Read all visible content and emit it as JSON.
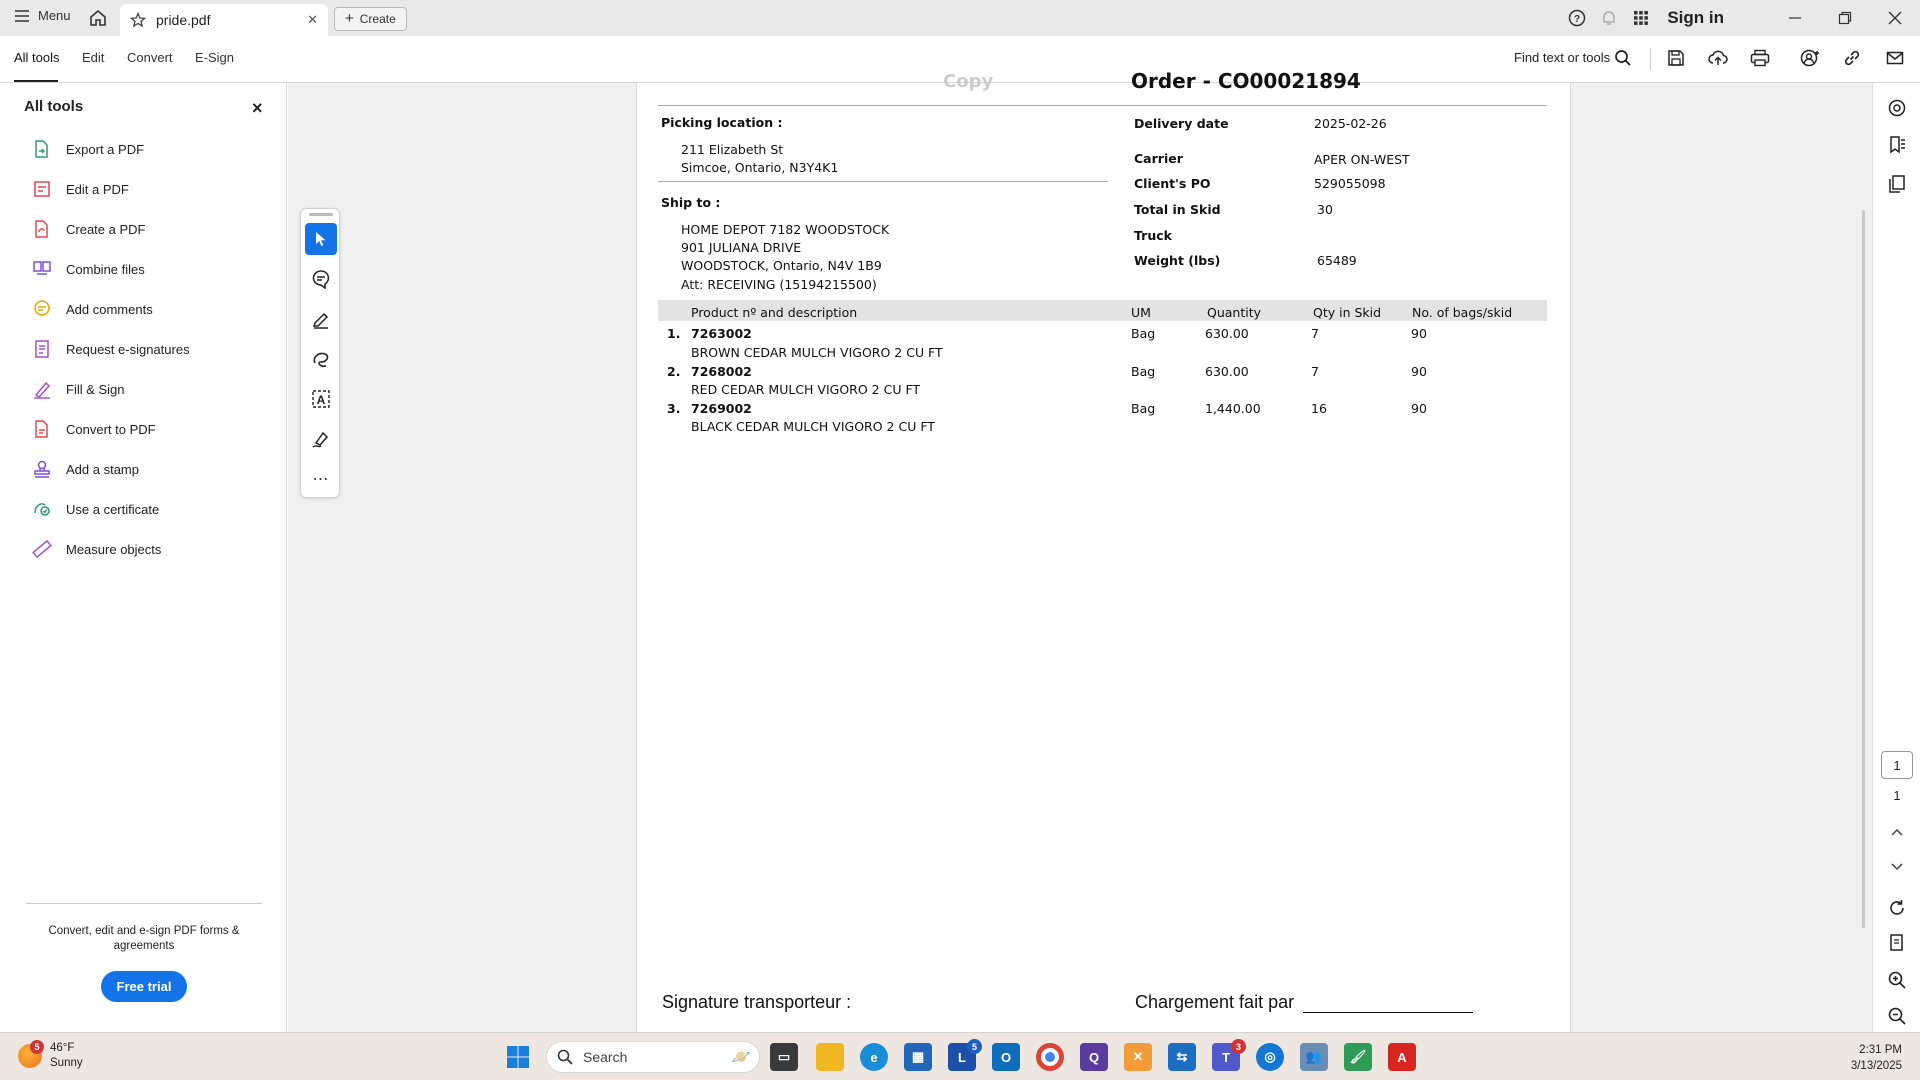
{
  "titlebar": {
    "menu_label": "Menu",
    "tab_title": "pride.pdf",
    "create_label": "Create",
    "signin_label": "Sign in"
  },
  "toolbar": {
    "tabs": [
      "All tools",
      "Edit",
      "Convert",
      "E-Sign"
    ],
    "find_label": "Find text or tools"
  },
  "left_panel": {
    "title": "All tools",
    "items": [
      {
        "label": "Export a PDF",
        "icon": "export-pdf-icon",
        "color": "#2d9d78"
      },
      {
        "label": "Edit a PDF",
        "icon": "edit-pdf-icon",
        "color": "#e34850"
      },
      {
        "label": "Create a PDF",
        "icon": "create-pdf-icon",
        "color": "#e34850"
      },
      {
        "label": "Combine files",
        "icon": "combine-files-icon",
        "color": "#7e4fdc"
      },
      {
        "label": "Add comments",
        "icon": "add-comments-icon",
        "color": "#e8a800"
      },
      {
        "label": "Request e-signatures",
        "icon": "request-esign-icon",
        "color": "#a54fd1"
      },
      {
        "label": "Fill & Sign",
        "icon": "fill-sign-icon",
        "color": "#a54fd1"
      },
      {
        "label": "Convert to PDF",
        "icon": "convert-pdf-icon",
        "color": "#e34850"
      },
      {
        "label": "Add a stamp",
        "icon": "stamp-icon",
        "color": "#7e4fdc"
      },
      {
        "label": "Use a certificate",
        "icon": "certificate-icon",
        "color": "#2d9d78"
      },
      {
        "label": "Measure objects",
        "icon": "measure-icon",
        "color": "#a54fd1"
      }
    ],
    "promo_text": "Convert, edit and e-sign PDF forms & agreements",
    "trial_label": "Free trial"
  },
  "document": {
    "watermark": "Copy",
    "order_title": "Order - CO00021894",
    "picking_label": "Picking location :",
    "picking_lines": [
      "211 Elizabeth St",
      "Simcoe, Ontario, N3Y4K1"
    ],
    "ship_label": "Ship to :",
    "ship_lines": [
      "HOME DEPOT 7182 WOODSTOCK",
      "901 JULIANA DRIVE",
      "WOODSTOCK, Ontario, N4V 1B9",
      "Att: RECEIVING (15194215500)"
    ],
    "fields": [
      {
        "label": "Delivery date",
        "value": "2025-02-26"
      },
      {
        "label": "Carrier",
        "value": "APER ON-WEST"
      },
      {
        "label": "Client's PO",
        "value": "529055098"
      },
      {
        "label": "Total in Skid",
        "value": "30"
      },
      {
        "label": "Truck",
        "value": ""
      },
      {
        "label": "Weight (lbs)",
        "value": "65489"
      }
    ],
    "table_headers": [
      "Product nº and description",
      "UM",
      "Quantity",
      "Qty in Skid",
      "No. of bags/skid"
    ],
    "rows": [
      {
        "num": "1.",
        "code": "7263002",
        "desc": "BROWN CEDAR MULCH VIGORO 2 CU FT",
        "um": "Bag",
        "qty": "630.00",
        "skid": "7",
        "bags": "90"
      },
      {
        "num": "2.",
        "code": "7268002",
        "desc": "RED CEDAR MULCH VIGORO 2 CU FT",
        "um": "Bag",
        "qty": "630.00",
        "skid": "7",
        "bags": "90"
      },
      {
        "num": "3.",
        "code": "7269002",
        "desc": "BLACK CEDAR MULCH VIGORO  2 CU FT",
        "um": "Bag",
        "qty": "1,440.00",
        "skid": "16",
        "bags": "90"
      }
    ],
    "signature_left": "Signature transporteur :",
    "signature_right": "Chargement fait par"
  },
  "right_rail": {
    "current_page": "1",
    "total_pages": "1"
  },
  "taskbar": {
    "weather_badge": "5",
    "temperature": "46°F",
    "condition": "Sunny",
    "search_placeholder": "Search",
    "lexique_badge": "5",
    "teams_badge": "3",
    "time": "2:31 PM",
    "date": "3/13/2025"
  }
}
